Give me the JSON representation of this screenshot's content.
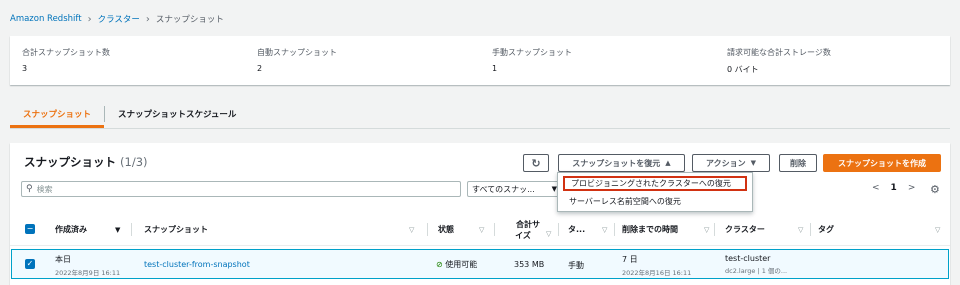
{
  "breadcrumb": {
    "items": [
      "Amazon Redshift",
      "クラスター"
    ],
    "current": "スナップショット"
  },
  "summary": [
    {
      "label": "合計スナップショット数",
      "value": "3"
    },
    {
      "label": "自動スナップショット",
      "value": "2"
    },
    {
      "label": "手動スナップショット",
      "value": "1"
    },
    {
      "label": "請求可能な合計ストレージ数",
      "value": "0 バイト"
    }
  ],
  "tabs": [
    {
      "label": "スナップショット",
      "active": true
    },
    {
      "label": "スナップショットスケジュール",
      "active": false
    }
  ],
  "panel": {
    "title": "スナップショット",
    "count": "(1/3)",
    "toolbar": {
      "refresh_icon": "refresh-icon",
      "restore_label": "スナップショットを復元",
      "actions_label": "アクション",
      "delete_label": "削除",
      "create_label": "スナップショットを作成"
    },
    "restore_menu": [
      "プロビジョニングされたクラスターへの復元",
      "サーバーレス名前空間への復元"
    ],
    "search_placeholder": "検索",
    "filter_value": "すべてのスナッ...",
    "pager": {
      "prev": "<",
      "page": "1",
      "next": ">"
    },
    "columns": [
      "作成済み",
      "スナップショット",
      "状態",
      "合計サイズ",
      "タ...",
      "削除までの時間",
      "クラスター",
      "タグ"
    ],
    "columns_split": {
      "size_line1": "合計サ",
      "size_line2": "イズ"
    },
    "rows": [
      {
        "created": "本日",
        "created_sub": "2022年8月9日 16:11",
        "snapshot": "test-cluster-from-snapshot",
        "status": "使用可能",
        "size": "353 MB",
        "type": "手動",
        "retention": "7 日",
        "retention_sub": "2022年8月16日 16:11",
        "cluster": "test-cluster",
        "cluster_sub": "dc2.large | 1 個の...",
        "tags": ""
      }
    ]
  },
  "colors": {
    "accent": "#ec7211",
    "link": "#0073bb",
    "highlight_border": "#d13212",
    "selected_row_bg": "#f1faff",
    "status_ok": "#1d8102"
  }
}
